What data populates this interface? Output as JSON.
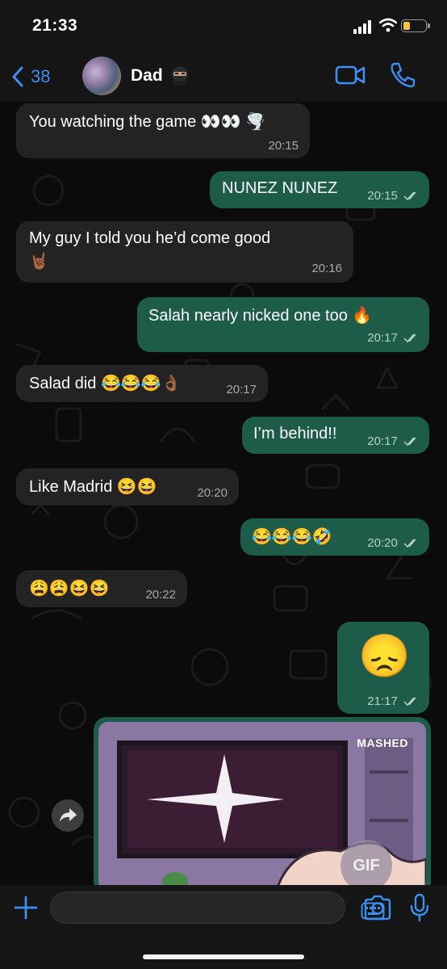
{
  "status_bar": {
    "time": "21:33"
  },
  "header": {
    "back_count": "38",
    "contact_name": "Dad"
  },
  "messages": [
    {
      "text": "You watching the game 👀👀 🌪️",
      "time": "20:15"
    },
    {
      "text": "NUNEZ NUNEZ",
      "time": "20:15"
    },
    {
      "text": "My guy I told you he’d come good 🤘🏾",
      "text_wrap": "🤘🏾",
      "time": "20:16"
    },
    {
      "text": "Salah nearly nicked one too 🔥",
      "time": "20:17"
    },
    {
      "text": "Salad did 😂😂😂👌🏾",
      "time": "20:17"
    },
    {
      "text": "I’m behind!!",
      "time": "20:17"
    },
    {
      "text": "Like Madrid 😆😆",
      "time": "20:20"
    },
    {
      "text": "😂😂😂🤣",
      "time": "20:20"
    },
    {
      "text": "😩😩😆😆",
      "time": "20:22"
    },
    {
      "text": "😞",
      "time": "21:17"
    }
  ],
  "gif": {
    "badge": "GIF",
    "watermark": "MASHED"
  },
  "colors": {
    "accent": "#3a8ff0",
    "incoming": "#232323",
    "outgoing": "#1c5c48",
    "background": "#0b0b0b"
  }
}
